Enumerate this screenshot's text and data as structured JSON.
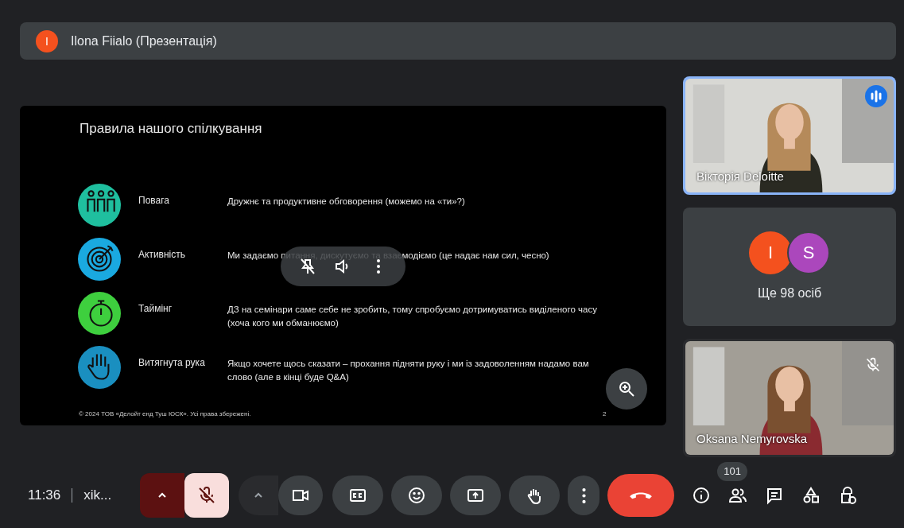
{
  "presenter_bar": {
    "avatar_letter": "I",
    "title": "Ilona Fiialo (Презентація)"
  },
  "slide": {
    "title": "Правила нашого спілкування",
    "rows": [
      {
        "color": "#1fbf9f",
        "label": "Повага",
        "text": "Дружнє та продуктивне обговорення (можемо на «ти»?)"
      },
      {
        "color": "#1aa9e0",
        "label": "Активність",
        "text": "Ми задаємо питання, дискутуємо та взаємодіємо (це надає нам сил, чесно)"
      },
      {
        "color": "#3ecf3e",
        "label": "Таймінг",
        "text": "ДЗ на семінари саме себе не зробить, тому спробуємо дотримуватись виділеного часу (хоча кого ми обманюємо)"
      },
      {
        "color": "#1a8fc0",
        "label": "Витягнута рука",
        "text": "Якщо хочете щось сказати – прохання підняти руку і ми із задоволенням надамо вам слово (але в кінці буде Q&A)"
      }
    ],
    "footer": "© 2024 ТОВ «Делойт енд Туш ЮСК». Усі права збережені.",
    "page_number": "2"
  },
  "tiles": [
    {
      "kind": "video",
      "name": "Вікторія Deloitte",
      "speaking": true,
      "muted": false
    },
    {
      "kind": "others",
      "avatars": [
        {
          "letter": "I",
          "color": "#f4511e"
        },
        {
          "letter": "S",
          "color": "#ab47bc"
        }
      ],
      "label": "Ще 98 осіб"
    },
    {
      "kind": "video",
      "name": "Oksana Nemyrovska",
      "speaking": false,
      "muted": true
    }
  ],
  "toolbar": {
    "time": "11:36",
    "meeting_code": "xik...",
    "mic_muted": true,
    "participants_count": "101"
  }
}
